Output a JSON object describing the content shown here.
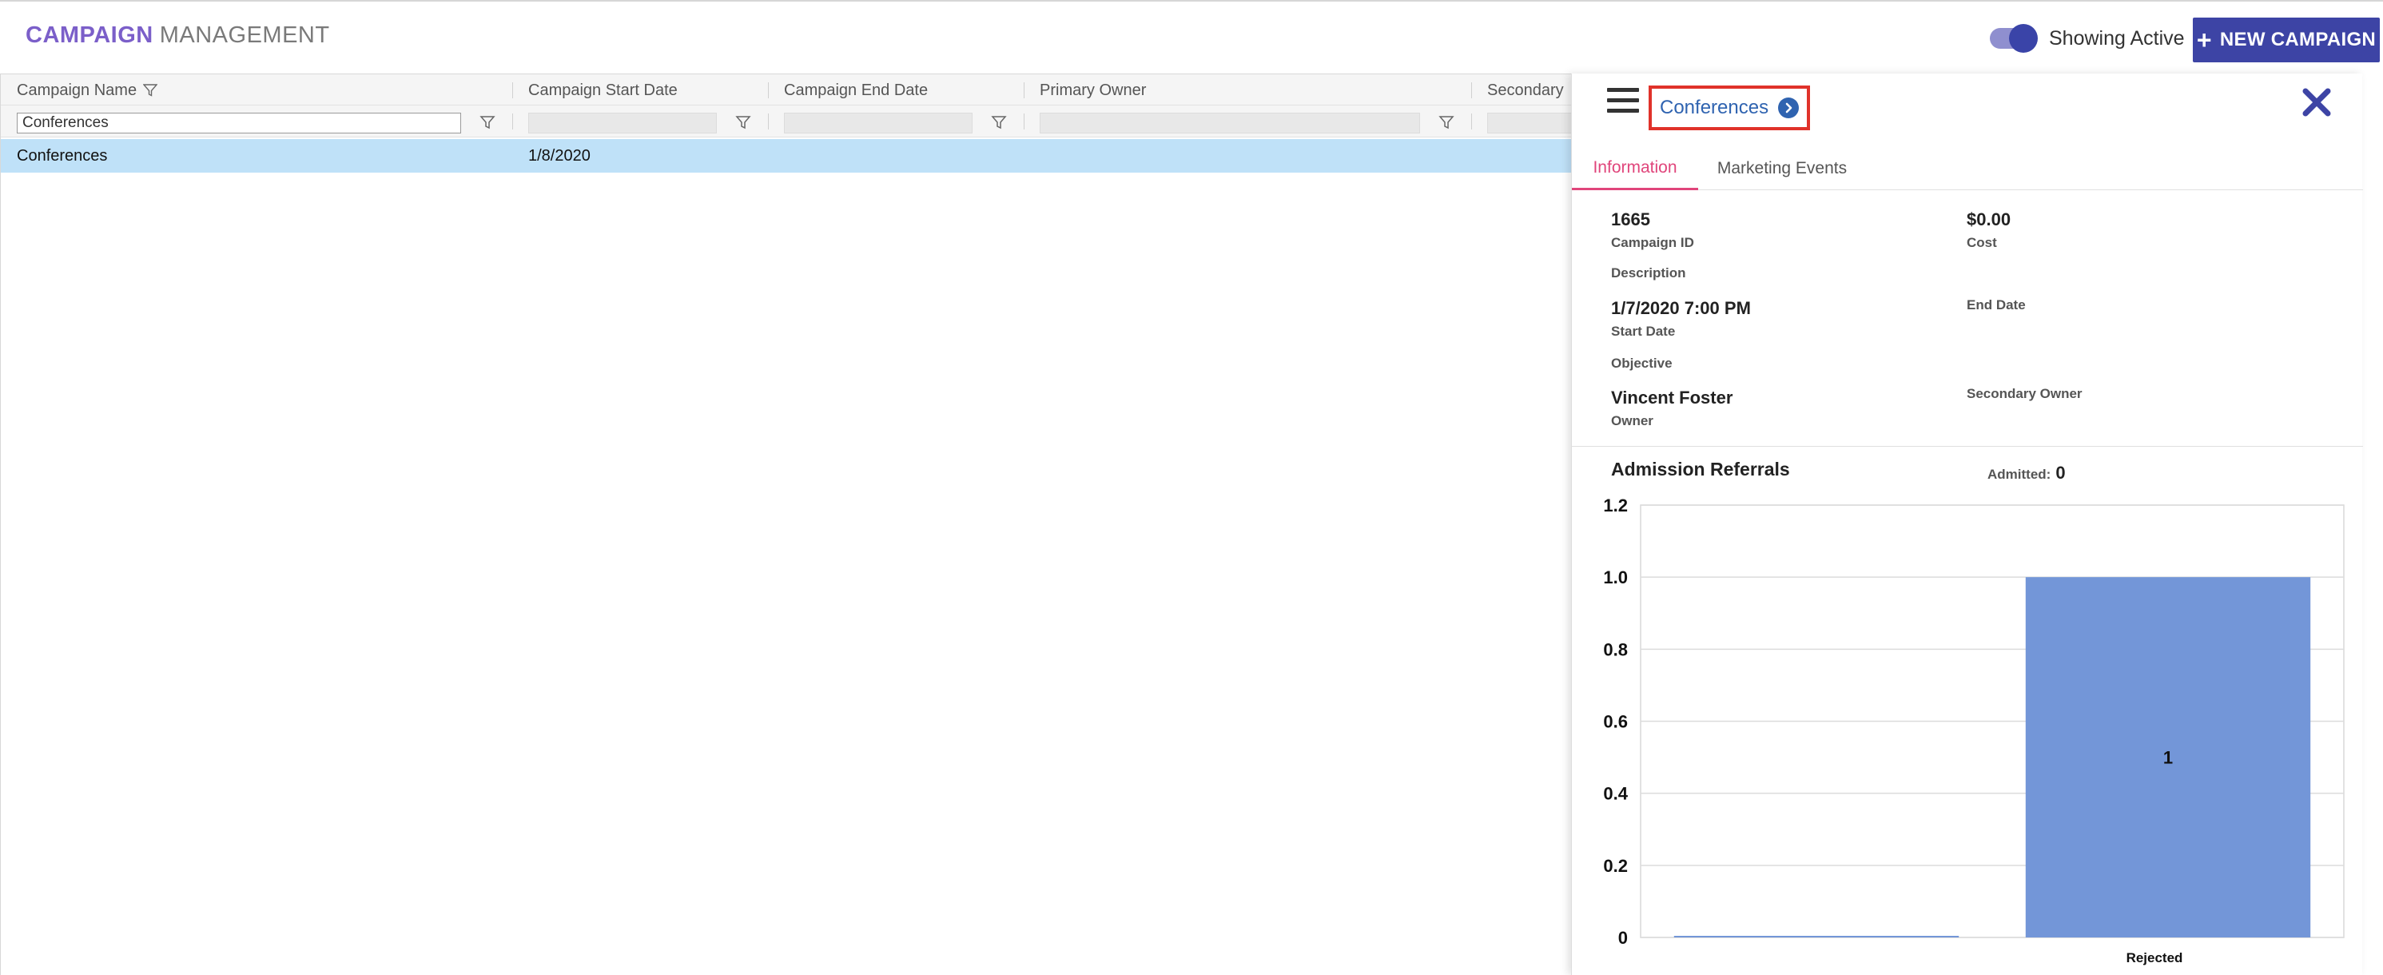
{
  "header": {
    "title_bold": "CAMPAIGN",
    "title_rest": "MANAGEMENT",
    "toggle_label": "Showing Active",
    "toggle_on": true,
    "new_button_label": "NEW CAMPAIGN"
  },
  "grid": {
    "columns": [
      "Campaign Name",
      "Campaign Start Date",
      "Campaign End Date",
      "Primary Owner",
      "Secondary"
    ],
    "filters": {
      "campaign_name": "Conferences"
    },
    "rows": [
      {
        "campaign_name": "Conferences",
        "start_date": "1/8/2020",
        "end_date": "",
        "primary_owner": "",
        "secondary": ""
      }
    ]
  },
  "panel": {
    "title": "Conferences",
    "tabs": [
      "Information",
      "Marketing Events"
    ],
    "active_tab": "Information",
    "fields": {
      "campaign_id": {
        "value": "1665",
        "label": "Campaign ID"
      },
      "cost": {
        "value": "$0.00",
        "label": "Cost"
      },
      "description": {
        "value": "",
        "label": "Description"
      },
      "start_date": {
        "value": "1/7/2020 7:00 PM",
        "label": "Start Date"
      },
      "end_date": {
        "value": "",
        "label": "End Date"
      },
      "objective": {
        "value": "",
        "label": "Objective"
      },
      "owner": {
        "value": "Vincent Foster",
        "label": "Owner"
      },
      "secondary_owner": {
        "value": "",
        "label": "Secondary Owner"
      }
    },
    "section_title": "Admission Referrals",
    "admitted_label": "Admitted",
    "admitted_value": "0"
  },
  "colors": {
    "accent": "#3d44a5",
    "title_purple": "#7b5fc9",
    "active_tab": "#e0457b",
    "selected_row": "#bfe1f8",
    "bar": "#7396d8",
    "highlight_box": "#e0322a"
  },
  "chart_data": {
    "type": "bar",
    "categories": [
      "",
      "Rejected"
    ],
    "values": [
      0,
      1
    ],
    "data_labels": [
      "",
      "1"
    ],
    "ylim": [
      0,
      1.2
    ],
    "yticks": [
      "0",
      "0.2",
      "0.4",
      "0.6",
      "0.8",
      "1.0",
      "1.2"
    ],
    "grid": true
  }
}
